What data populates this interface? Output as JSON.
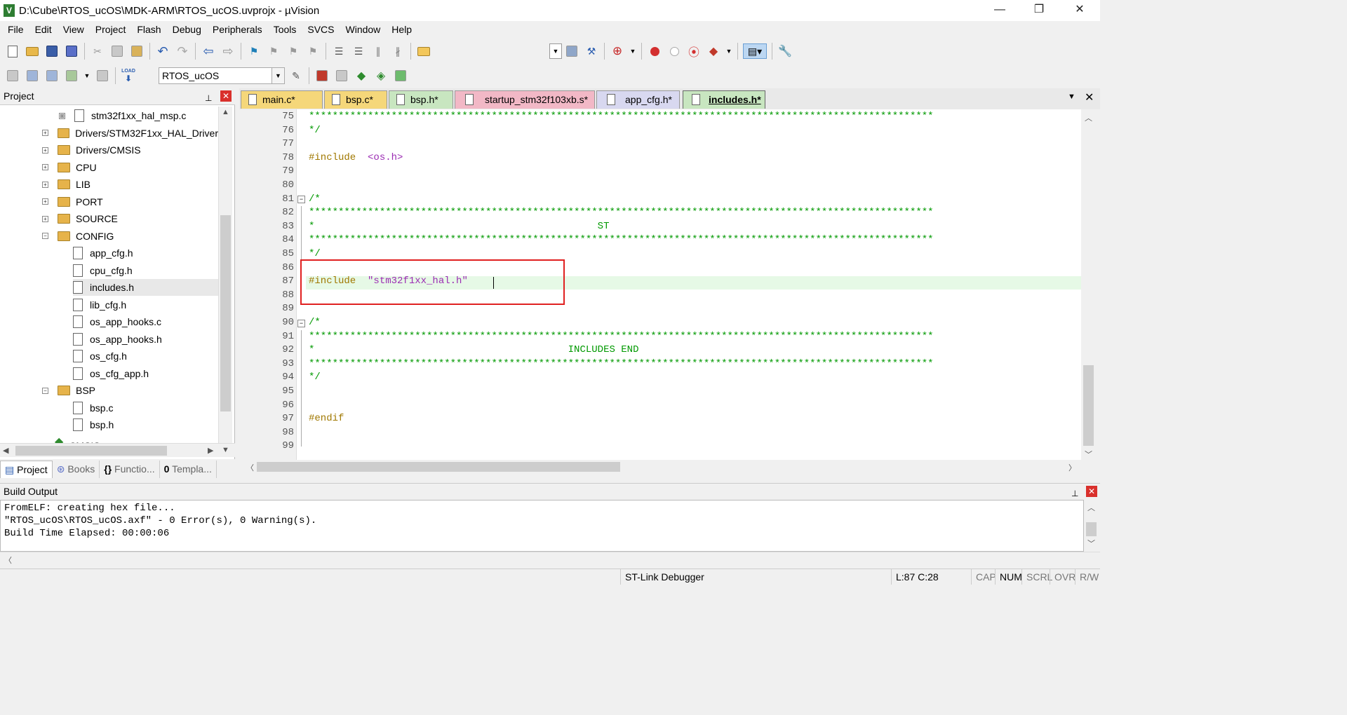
{
  "window": {
    "title": "D:\\Cube\\RTOS_ucOS\\MDK-ARM\\RTOS_ucOS.uvprojx - µVision",
    "minimize_glyph": "—",
    "restore_glyph": "❐",
    "close_glyph": "✕"
  },
  "menubar": [
    "File",
    "Edit",
    "View",
    "Project",
    "Flash",
    "Debug",
    "Peripherals",
    "Tools",
    "SVCS",
    "Window",
    "Help"
  ],
  "toolbar2": {
    "target": "RTOS_ucOS",
    "load_label": "LOAD"
  },
  "project_panel": {
    "title": "Project",
    "pin_glyph": "📌",
    "close_glyph": "✕",
    "tree": [
      {
        "label": "stm32f1xx_hal_msp.c",
        "kind": "file",
        "expand": "⊞"
      },
      {
        "label": "Drivers/STM32F1xx_HAL_Driver",
        "kind": "folder",
        "expand": "+"
      },
      {
        "label": "Drivers/CMSIS",
        "kind": "folder",
        "expand": "+"
      },
      {
        "label": "CPU",
        "kind": "folder",
        "expand": "+"
      },
      {
        "label": "LIB",
        "kind": "folder",
        "expand": "+"
      },
      {
        "label": "PORT",
        "kind": "folder",
        "expand": "+"
      },
      {
        "label": "SOURCE",
        "kind": "folder",
        "expand": "+"
      },
      {
        "label": "CONFIG",
        "kind": "folder-open",
        "expand": "−"
      },
      {
        "label": "app_cfg.h",
        "kind": "file"
      },
      {
        "label": "cpu_cfg.h",
        "kind": "file"
      },
      {
        "label": "includes.h",
        "kind": "file",
        "selected": true
      },
      {
        "label": "lib_cfg.h",
        "kind": "file"
      },
      {
        "label": "os_app_hooks.c",
        "kind": "file"
      },
      {
        "label": "os_app_hooks.h",
        "kind": "file"
      },
      {
        "label": "os_cfg.h",
        "kind": "file"
      },
      {
        "label": "os_cfg_app.h",
        "kind": "file"
      },
      {
        "label": "BSP",
        "kind": "folder-open",
        "expand": "−"
      },
      {
        "label": "bsp.c",
        "kind": "file"
      },
      {
        "label": "bsp.h",
        "kind": "file"
      },
      {
        "label": "CMSIS",
        "kind": "component"
      }
    ],
    "tabs": [
      "Project",
      "Books",
      "Functio...",
      "Templa..."
    ],
    "tab_glyphs": [
      "▤",
      "⊛",
      "{}",
      "0"
    ]
  },
  "editor_tabs": [
    {
      "label": "main.c*",
      "color": "#f5d77a"
    },
    {
      "label": "bsp.c*",
      "color": "#f5d77a"
    },
    {
      "label": "bsp.h*",
      "color": "#c8e6c0"
    },
    {
      "label": "startup_stm32f103xb.s*",
      "color": "#f2b8c6"
    },
    {
      "label": "app_cfg.h*",
      "color": "#d8d8f0"
    },
    {
      "label": "includes.h*",
      "color": "#c8e6c0",
      "active": true
    }
  ],
  "editor": {
    "line_numbers": [
      "75",
      "76",
      "77",
      "78",
      "79",
      "80",
      "81",
      "82",
      "83",
      "84",
      "85",
      "86",
      "87",
      "88",
      "89",
      "90",
      "91",
      "92",
      "93",
      "94",
      "95",
      "96",
      "97",
      "98",
      "99"
    ],
    "stars": "**********************************************************************************************************",
    "l76": "*/",
    "l78_directive": "#include",
    "l78_path": "  <os.h>",
    "l81": "/*",
    "l83": "*                                                ST",
    "l85": "*/",
    "l87_directive": "#include",
    "l87_path": "  \"stm32f1xx_hal.h\"",
    "l90": "/*",
    "l92": "*                                           INCLUDES END",
    "l94": "*/",
    "l97": "#endif",
    "fold_glyph": "−"
  },
  "build_output": {
    "title": "Build Output",
    "lines": [
      "FromELF: creating hex file...",
      "\"RTOS_ucOS\\RTOS_ucOS.axf\" - 0 Error(s), 0 Warning(s).",
      "Build Time Elapsed:  00:00:06"
    ]
  },
  "statusbar": {
    "debugger": "ST-Link Debugger",
    "position": "L:87 C:28",
    "cap": "CAP",
    "num": "NUM",
    "scrl": "SCRL",
    "ovr": "OVR",
    "rw": "R/W"
  },
  "colors": {
    "comment": "#009900",
    "preprocessor": "#a07800",
    "include_path": "#9b2cb3",
    "current_line": "#e6f9e6",
    "annotation": "#e02020"
  }
}
